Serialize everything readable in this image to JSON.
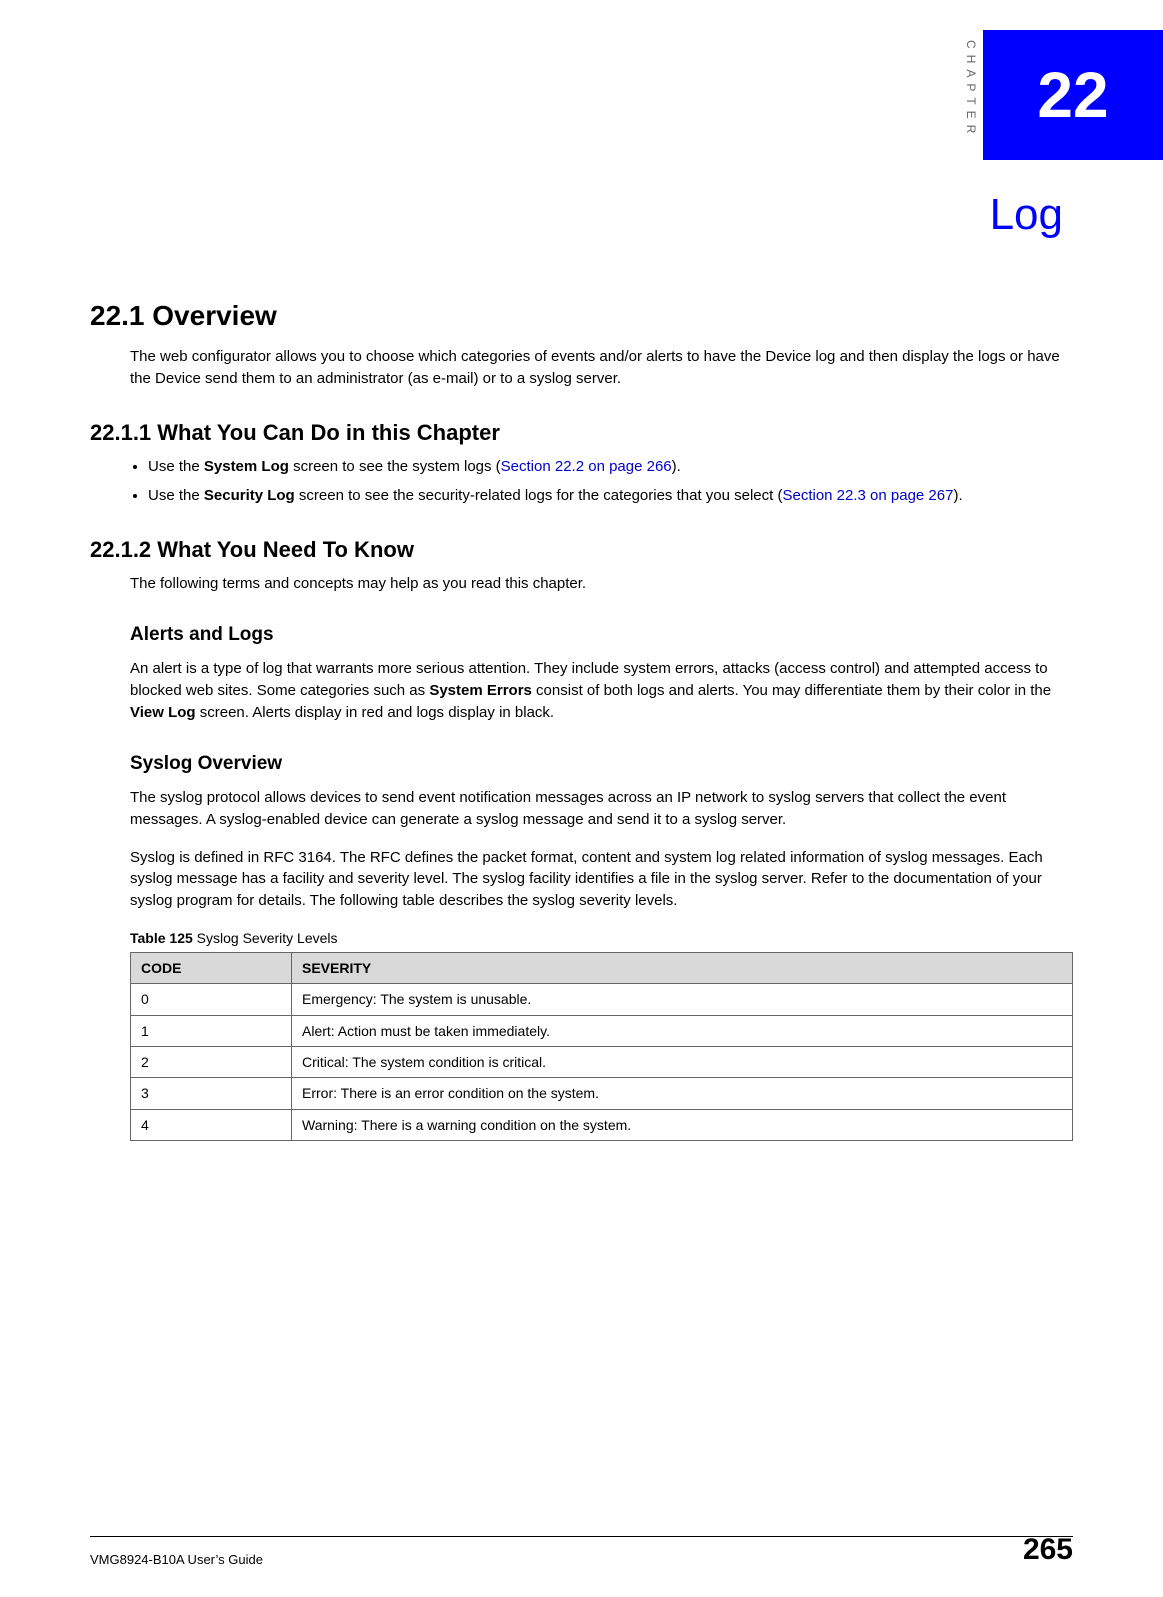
{
  "chapter": {
    "label_vertical": "CHAPTER",
    "number": "22",
    "title": "Log"
  },
  "section_22_1": {
    "heading": "22.1  Overview",
    "p1": "The web configurator allows you to choose which categories of events and/or alerts to have the Device log and then display the logs or have the Device send them to an administrator (as e-mail) or to a syslog server."
  },
  "section_22_1_1": {
    "heading": "22.1.1  What You Can Do in this Chapter",
    "bullet1_pre": "Use the ",
    "bullet1_bold": "System Log",
    "bullet1_mid": " screen to see the system logs (",
    "bullet1_xref": "Section 22.2 on page 266",
    "bullet1_post": ").",
    "bullet2_pre": "Use the ",
    "bullet2_bold": "Security Log",
    "bullet2_mid": " screen to see the security-related logs for the categories that you select (",
    "bullet2_xref": "Section 22.3 on page 267",
    "bullet2_post": ")."
  },
  "section_22_1_2": {
    "heading": "22.1.2  What You Need To Know",
    "intro": "The following terms and concepts may help as you read this chapter.",
    "alerts_heading": "Alerts and Logs",
    "alerts_p_pre": "An alert is a type of log that warrants more serious attention. They include system errors, attacks (access control) and attempted access to blocked web sites. Some categories such as ",
    "alerts_p_b1": "System Errors",
    "alerts_p_mid": " consist of both logs and alerts. You may differentiate them by their color in the ",
    "alerts_p_b2": "View Log",
    "alerts_p_post": " screen. Alerts display in red and logs display in black.",
    "syslog_heading": "Syslog Overview",
    "syslog_p1": "The syslog protocol allows devices to send event notification messages across an IP network to syslog servers that collect the event messages. A syslog-enabled device can generate a syslog message and send it to a syslog server.",
    "syslog_p2": "Syslog is defined in RFC 3164. The RFC defines the packet format, content and system log related information of syslog messages. Each syslog message has a facility and severity level. The syslog facility identifies a file in the syslog server. Refer to the documentation of your syslog program for details. The following table describes the syslog severity levels."
  },
  "table": {
    "caption_prefix": "Table 125   ",
    "caption_title": "Syslog Severity Levels",
    "headers": {
      "code": "CODE",
      "severity": "SEVERITY"
    },
    "rows": [
      {
        "code": "0",
        "severity": "Emergency: The system is unusable."
      },
      {
        "code": "1",
        "severity": "Alert: Action must be taken immediately."
      },
      {
        "code": "2",
        "severity": "Critical: The system condition is critical."
      },
      {
        "code": "3",
        "severity": "Error: There is an error condition on the system."
      },
      {
        "code": "4",
        "severity": "Warning: There is a warning condition on the system."
      }
    ]
  },
  "footer": {
    "guide": "VMG8924-B10A User’s Guide",
    "page": "265"
  }
}
